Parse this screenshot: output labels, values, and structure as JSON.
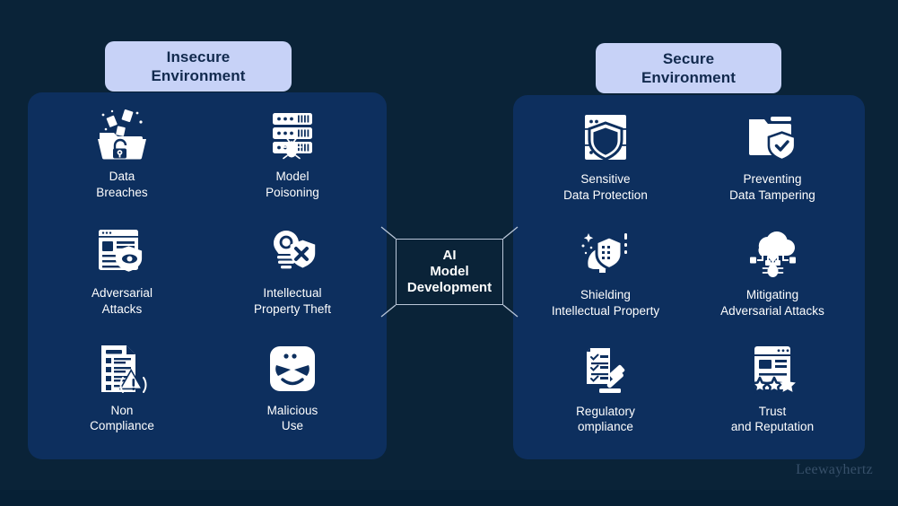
{
  "meta": {
    "watermark": "Leewayhertz",
    "background_color": "#0a2338",
    "panel_color": "#0d2f5e",
    "pill_color": "#c7d2f7",
    "pill_text_color": "#122a4e",
    "icon_color": "#ffffff",
    "label_color": "#ffffff",
    "watermark_color": "#37506a"
  },
  "center": {
    "title": "AI\nModel\nDevelopment"
  },
  "left_panel": {
    "header": "Insecure\nEnvironment",
    "items": [
      {
        "label": "Data\nBreaches",
        "icon": "folder-unlocked-breach-icon"
      },
      {
        "label": "Model\nPoisoning",
        "icon": "server-bug-icon"
      },
      {
        "label": "Adversarial\nAttacks",
        "icon": "browser-shield-eye-icon"
      },
      {
        "label": "Intellectual\nProperty Theft",
        "icon": "lightbulb-shield-cross-icon"
      },
      {
        "label": "Non\nCompliance",
        "icon": "checklist-warning-icon"
      },
      {
        "label": "Malicious\nUse",
        "icon": "malicious-face-icon"
      }
    ]
  },
  "right_panel": {
    "header": "Secure\nEnvironment",
    "items": [
      {
        "label": "Sensitive\nData Protection",
        "icon": "server-shield-icon"
      },
      {
        "label": "Preventing\nData Tampering",
        "icon": "folder-shield-check-icon"
      },
      {
        "label": "Shielding\nIntellectual Property",
        "icon": "head-shield-sparkle-icon"
      },
      {
        "label": "Mitigating\nAdversarial Attacks",
        "icon": "cloud-bug-block-icon"
      },
      {
        "label": "Regulatory\nompliance",
        "icon": "checklist-gavel-icon"
      },
      {
        "label": "Trust\nand Reputation",
        "icon": "browser-stars-icon"
      }
    ]
  }
}
